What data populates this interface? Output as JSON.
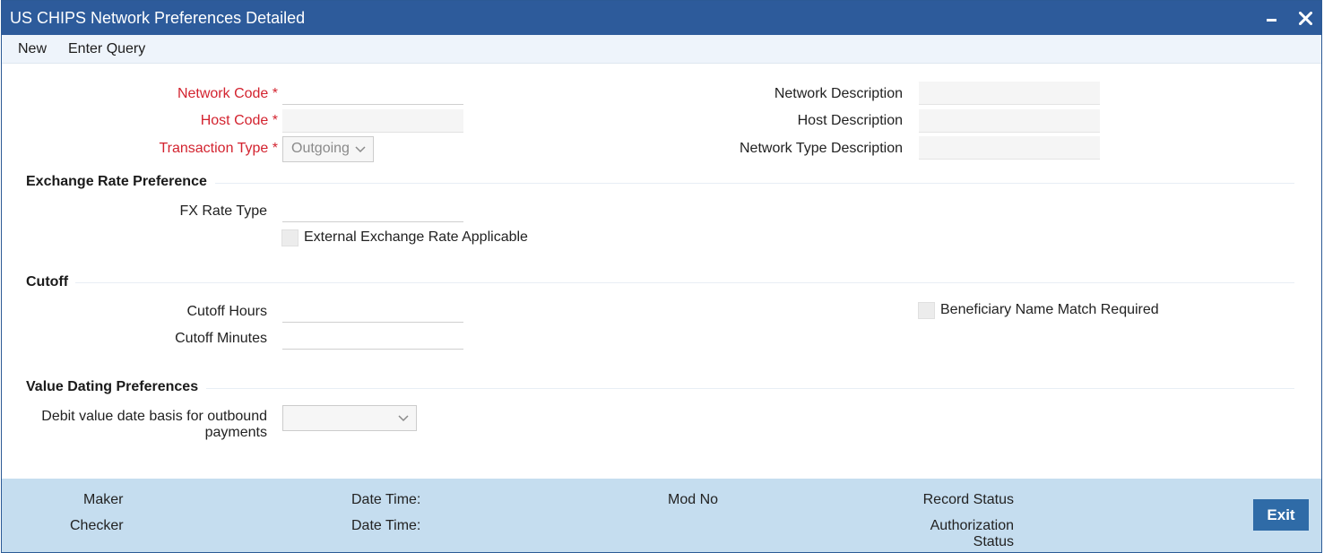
{
  "window": {
    "title": "US CHIPS Network Preferences Detailed"
  },
  "menu": {
    "new": "New",
    "enter_query": "Enter Query"
  },
  "form": {
    "network_code_label": "Network Code",
    "network_code_value": "",
    "host_code_label": "Host Code",
    "host_code_value": "",
    "transaction_type_label": "Transaction Type",
    "transaction_type_value": "Outgoing",
    "required_marker": "*",
    "network_description_label": "Network Description",
    "network_description_value": "",
    "host_description_label": "Host Description",
    "host_description_value": "",
    "network_type_description_label": "Network Type Description",
    "network_type_description_value": ""
  },
  "exchange_rate": {
    "heading": "Exchange Rate Preference",
    "fx_rate_type_label": "FX Rate Type",
    "fx_rate_type_value": "",
    "external_rate_label": "External Exchange Rate Applicable",
    "external_rate_checked": false
  },
  "cutoff": {
    "heading": "Cutoff",
    "hours_label": "Cutoff Hours",
    "hours_value": "",
    "minutes_label": "Cutoff Minutes",
    "minutes_value": "",
    "beneficiary_label": "Beneficiary Name Match Required",
    "beneficiary_checked": false
  },
  "value_dating": {
    "heading": "Value Dating Preferences",
    "debit_basis_label_line1": "Debit value date basis for outbound",
    "debit_basis_label_line2": "payments",
    "debit_basis_value": ""
  },
  "footer": {
    "maker": "Maker",
    "checker": "Checker",
    "date_time_1": "Date Time:",
    "date_time_2": "Date Time:",
    "mod_no": "Mod No",
    "record_status": "Record Status",
    "authorization_line1": "Authorization",
    "authorization_line2": "Status",
    "exit": "Exit"
  },
  "colors": {
    "titlebar": "#2d5b9b",
    "required_label": "#d3232f",
    "footer": "#c5ddef",
    "exit_button": "#2f6ba7"
  }
}
